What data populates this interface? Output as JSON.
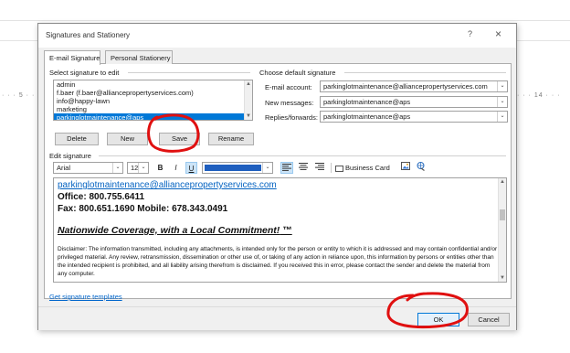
{
  "background": {
    "ruler_left": "· · · 5 · · ·",
    "ruler_right": "· · · 14 · · ·"
  },
  "dialog": {
    "title": "Signatures and Stationery",
    "help": "?",
    "close": "×"
  },
  "tabs": [
    {
      "label": "E-mail Signature"
    },
    {
      "label": "Personal Stationery"
    }
  ],
  "select_section": {
    "heading": "Select signature to edit",
    "items": [
      "admin",
      "f.baer (f.baer@alliancepropertyservices.com)",
      "info@happy-lawn",
      "marketing",
      "parkinglotmaintenance@aps"
    ],
    "selected_index": 4
  },
  "buttons": {
    "delete": "Delete",
    "new": "New",
    "save": "Save",
    "rename": "Rename",
    "business_card": "Business Card",
    "ok": "OK",
    "cancel": "Cancel"
  },
  "default_section": {
    "heading": "Choose default signature",
    "email_account_label": "E-mail account:",
    "email_account_value": "parkinglotmaintenance@alliancepropertyservices.com",
    "new_messages_label": "New messages:",
    "new_messages_value": "parkinglotmaintenance@aps",
    "replies_label": "Replies/forwards:",
    "replies_value": "parkinglotmaintenance@aps"
  },
  "edit_section": {
    "heading": "Edit signature",
    "font": "Arial",
    "size": "12",
    "bold": "B",
    "italic": "I",
    "underline": "U",
    "font_color": "#1f5fbf"
  },
  "editor": {
    "email_link": "parkinglotmaintenance@alliancepropertyservices.com",
    "office": "Office: 800.755.6411",
    "fax_mobile": "Fax: 800.651.1690 Mobile: 678.343.0491",
    "slogan": "Nationwide Coverage, with a Local Commitment!",
    "trademark": " ™",
    "disclaimer": "Disclaimer: The information transmitted, including any attachments, is intended only for the person or entity to which it is addressed and may contain confidential and/or privileged material. Any review, retransmission, dissemination or other use of, or taking of any action in reliance upon, this information by persons or entities other than the intended recipient is prohibited, and all liability arising therefrom is disclaimed. If you received this in error, please contact the sender and delete the material from any computer."
  },
  "templates_link": "Get signature templates",
  "colors": {
    "annotation": "#e01010",
    "selection": "#0078d7",
    "link": "#0563c1"
  }
}
